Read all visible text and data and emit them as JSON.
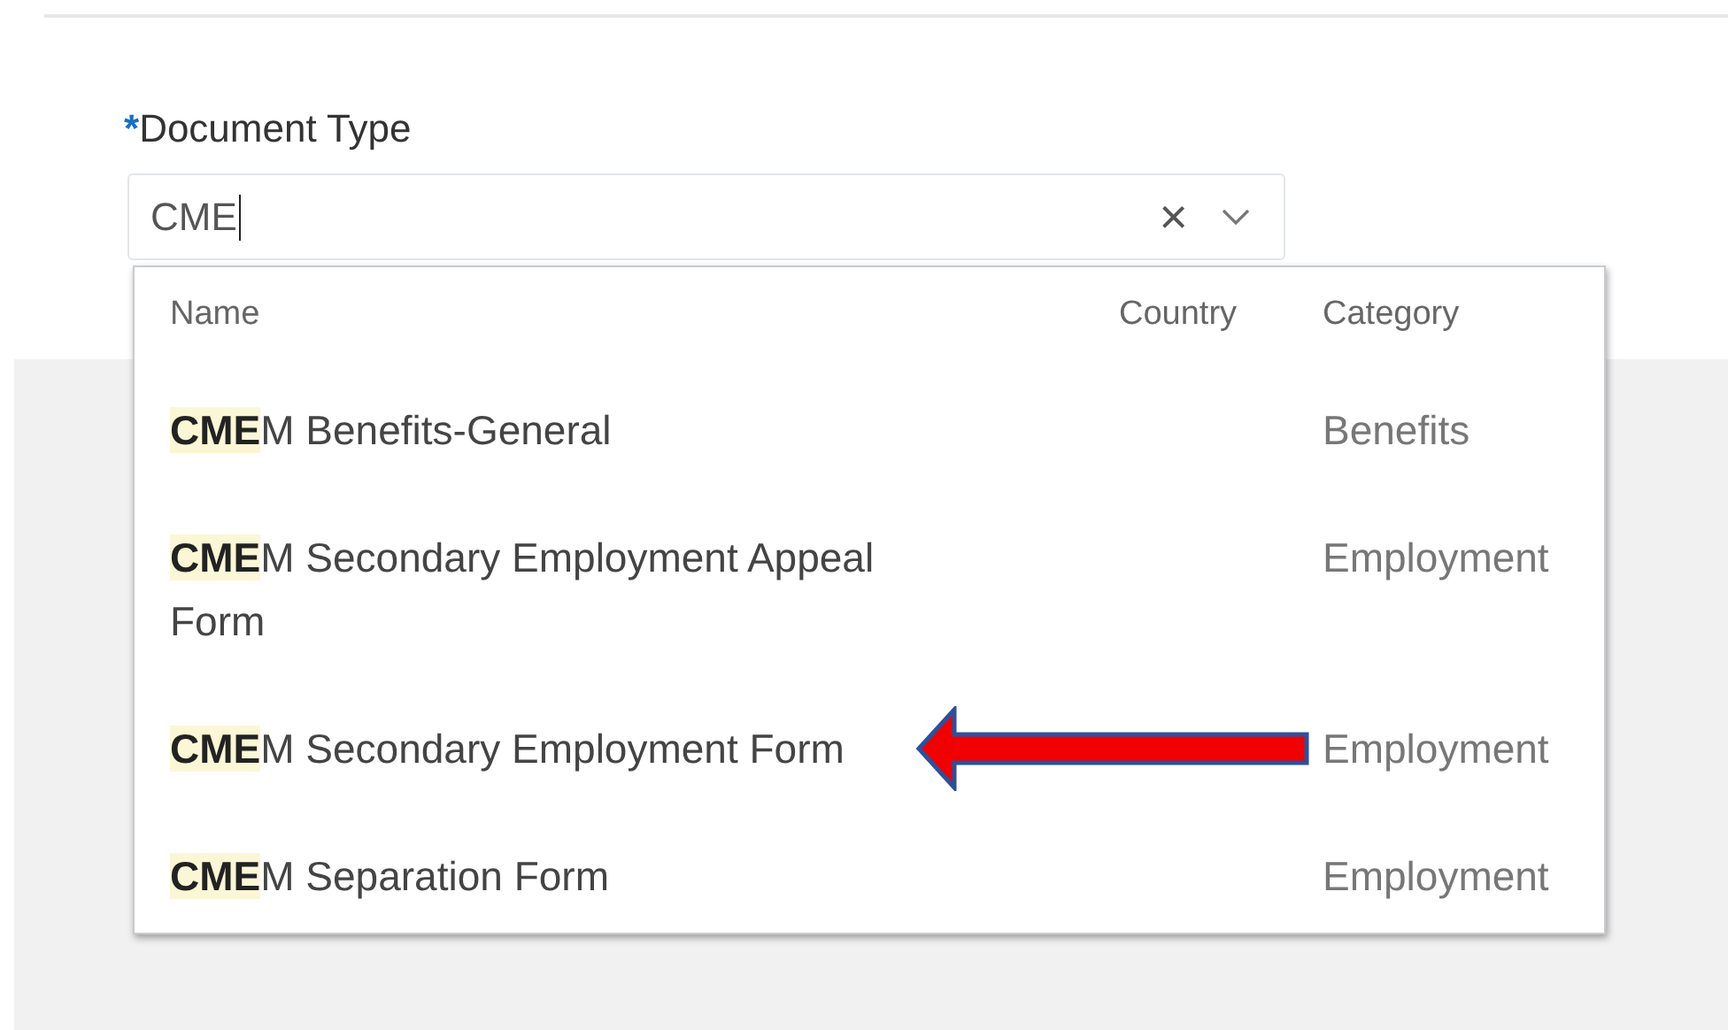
{
  "field": {
    "label": "Document Type",
    "required_mark": "*",
    "value": "CME",
    "clear_icon": "×",
    "expanded": true
  },
  "dropdown": {
    "columns": [
      "Name",
      "Country",
      "Category"
    ],
    "rows": [
      {
        "name": "**CME**M Benefits-General",
        "category": "Benefits",
        "annotated": false
      },
      {
        "name": "**CME**M Secondary Employment Appeal Form",
        "category": "Employment",
        "annotated": false
      },
      {
        "name": "**CME**M Secondary Employment Form",
        "category": "Employment",
        "annotated": true
      },
      {
        "name": "**CME**M Separation Form",
        "category": "Employment",
        "annotated": false
      }
    ]
  }
}
